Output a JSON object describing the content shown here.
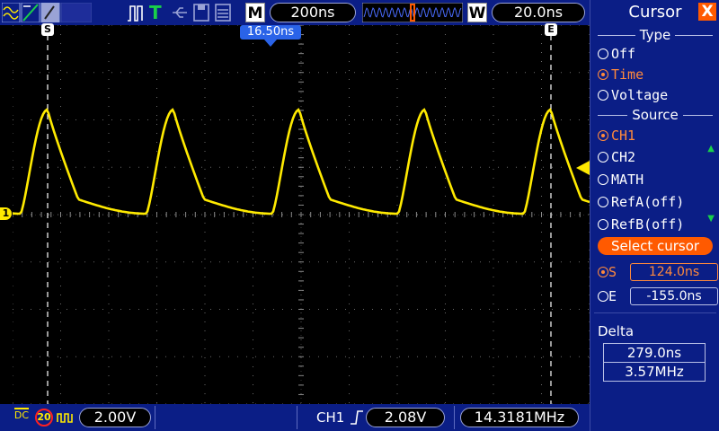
{
  "toolbar": {
    "mode": "M",
    "timebase": "200ns",
    "window_mode": "W",
    "window_value": "20.0ns",
    "trigger_state_label": "T"
  },
  "screen": {
    "trigger_position": "16.50ns",
    "cursor_s_marker": "S",
    "cursor_e_marker": "E",
    "channel_marker": "1"
  },
  "bottom": {
    "coupling": "DC",
    "bw_limit": "20",
    "ch1_volts": "2.00V",
    "trig_source": "CH1",
    "trig_level": "2.08V",
    "frequency": "14.3181MHz"
  },
  "panel": {
    "title": "Cursor",
    "close": "X",
    "type_heading": "Type",
    "type_options": [
      {
        "label": "Off",
        "selected": false
      },
      {
        "label": "Time",
        "selected": true
      },
      {
        "label": "Voltage",
        "selected": false
      }
    ],
    "source_heading": "Source",
    "source_options": [
      {
        "label": "CH1",
        "selected": true
      },
      {
        "label": "CH2",
        "selected": false
      },
      {
        "label": "MATH",
        "selected": false
      },
      {
        "label": "RefA(off)",
        "selected": false
      },
      {
        "label": "RefB(off)",
        "selected": false
      }
    ],
    "select_cursor": "Select cursor",
    "cursor_s_label": "S",
    "cursor_s_value": "124.0ns",
    "cursor_e_label": "E",
    "cursor_e_value": "-155.0ns",
    "delta_heading": "Delta",
    "delta_time": "279.0ns",
    "delta_freq": "3.57MHz"
  },
  "colors": {
    "trace": "#ffea00",
    "bar": "#0b1e86",
    "accent": "#ff5a00",
    "selected": "#ff8a3c"
  }
}
